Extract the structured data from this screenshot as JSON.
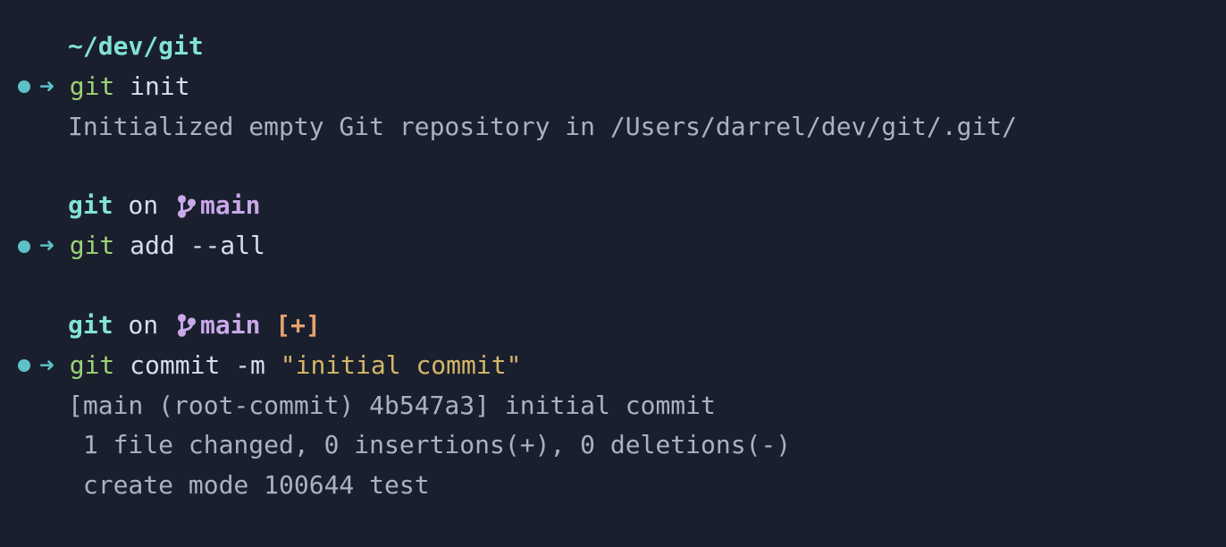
{
  "prompt1": {
    "cwd": "~/dev/git",
    "arrow": "➜",
    "cmd_git": "git",
    "cmd_args": " init"
  },
  "output1": "Initialized empty Git repository in /Users/darrel/dev/git/.git/",
  "prompt2": {
    "repo": "git",
    "on": " on ",
    "branch": "main",
    "arrow": "➜",
    "cmd_git": "git",
    "cmd_args": " add --all"
  },
  "prompt3": {
    "repo": "git",
    "on": " on ",
    "branch": "main",
    "status": " [+]",
    "arrow": "➜",
    "cmd_git": "git",
    "cmd_args": " commit -m ",
    "cmd_quote": "\"initial commit\""
  },
  "output3": {
    "line1": "[main (root-commit) 4b547a3] initial commit",
    "line2": " 1 file changed, 0 insertions(+), 0 deletions(-)",
    "line3": " create mode 100644 test"
  }
}
